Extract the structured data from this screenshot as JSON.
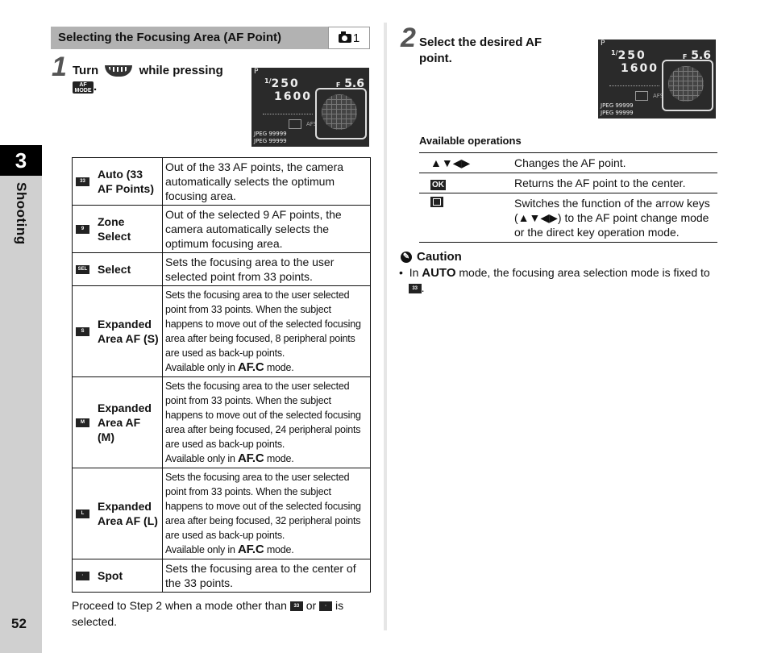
{
  "sidebar": {
    "chapter_number": "3",
    "chapter_label": "Shooting",
    "page_number": "52"
  },
  "section": {
    "title": "Selecting the Focusing Area (AF Point)",
    "mode_badge": "1",
    "mode_icon": "camera-icon"
  },
  "step1": {
    "number": "1",
    "text_before": "Turn",
    "dial_icon": "rear-e-dial-icon",
    "text_after": "while pressing",
    "button_icon": "af-mode-button-icon",
    "button_label": "AF\nMODE",
    "end": "."
  },
  "step2": {
    "number": "2",
    "text": "Select the desired AF point."
  },
  "lcd": {
    "mode": "P",
    "shutter_prefix": "1/",
    "shutter": "250",
    "aperture_prefix": "F",
    "aperture": "5.6",
    "iso": "1600",
    "af_mode": "AFS",
    "file1": "JPEG 99999",
    "file2": "JPEG 99999"
  },
  "modes": [
    {
      "icon": "af-auto-33-icon",
      "icon_label": "33",
      "name": "Auto (33 AF Points)",
      "desc": "Out of the 33 AF points, the camera automatically selects the optimum focusing area."
    },
    {
      "icon": "af-zone-select-icon",
      "icon_label": "9",
      "name": "Zone Select",
      "desc": "Out of the selected 9 AF points, the camera automatically selects the optimum focusing area."
    },
    {
      "icon": "af-select-icon",
      "icon_label": "SEL",
      "name": "Select",
      "desc": "Sets the focusing area to the user selected point from 33 points."
    },
    {
      "icon": "af-expanded-s-icon",
      "icon_label": "S",
      "name": "Expanded Area AF (S)",
      "desc": "Sets the focusing area to the user selected point from 33 points. When the subject happens to move out of the selected focusing area after being focused, 8 peripheral points are used as back-up points.",
      "avail_before": "Available only in",
      "avail_mode": "AF.C",
      "avail_after": "mode."
    },
    {
      "icon": "af-expanded-m-icon",
      "icon_label": "M",
      "name": "Expanded Area AF (M)",
      "desc": "Sets the focusing area to the user selected point from 33 points. When the subject happens to move out of the selected focusing area after being focused, 24 peripheral points are used as back-up points.",
      "avail_before": "Available only in",
      "avail_mode": "AF.C",
      "avail_after": "mode."
    },
    {
      "icon": "af-expanded-l-icon",
      "icon_label": "L",
      "name": "Expanded Area AF (L)",
      "desc": "Sets the focusing area to the user selected point from 33 points. When the subject happens to move out of the selected focusing area after being focused, 32 peripheral points are used as back-up points.",
      "avail_before": "Available only in",
      "avail_mode": "AF.C",
      "avail_after": "mode."
    },
    {
      "icon": "af-spot-icon",
      "icon_label": "·",
      "name": "Spot",
      "desc": "Sets the focusing area to the center of the 33 points."
    }
  ],
  "note": {
    "before": "Proceed to Step 2 when a mode other than",
    "icon1": "33",
    "middle": "or",
    "icon2": "·",
    "after": "is selected."
  },
  "operations": {
    "title": "Available operations",
    "rows": [
      {
        "key": "▲▼◀▶",
        "key_icon": "arrow-keys-icon",
        "desc": "Changes the AF point."
      },
      {
        "key": "OK",
        "key_icon": "ok-button-icon",
        "desc": "Returns the AF point to the center."
      },
      {
        "key": "",
        "key_icon": "af-point-button-icon",
        "desc": "Switches the function of the arrow keys (▲▼◀▶) to the AF point change mode or the direct key operation mode."
      }
    ]
  },
  "caution": {
    "title": "Caution",
    "bullet": "•",
    "before": "In",
    "mode": "AUTO",
    "after": "mode, the focusing area selection mode is fixed to",
    "icon_label": "33",
    "end": "."
  }
}
